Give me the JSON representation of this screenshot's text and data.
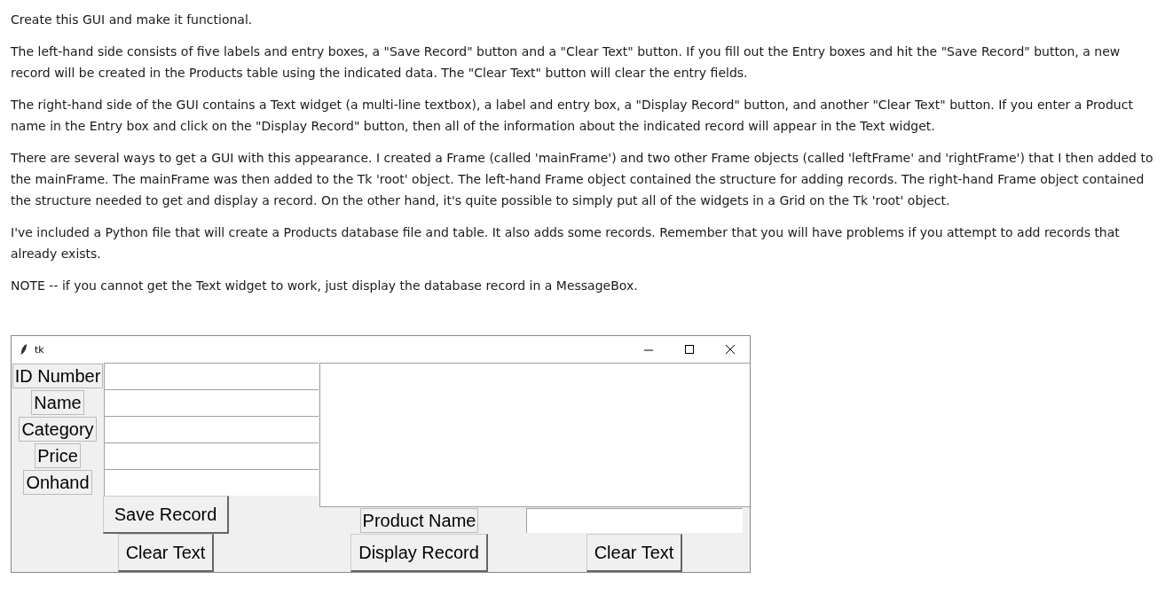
{
  "instructions": [
    "Create this GUI and make it functional.",
    "The left-hand side consists of five labels and entry boxes, a \"Save Record\" button and a \"Clear Text\" button.  If you fill out the Entry boxes and hit the \"Save Record\" button, a new record will be created in the Products table using the indicated data.  The \"Clear Text\" button will clear the entry fields.",
    "The right-hand side of the GUI contains a Text widget (a multi-line textbox), a label and entry box, a \"Display Record\" button, and another \"Clear Text\" button. If you enter a Product name in the Entry box and click on the \"Display Record\" button, then all of the information about the indicated record will appear in the Text widget.",
    "There are several ways to get a GUI with this appearance.  I created a Frame (called 'mainFrame') and two other Frame objects (called 'leftFrame' and 'rightFrame') that I then added to the mainFrame.  The mainFrame was then added to the Tk 'root' object.   The left-hand Frame object contained the structure for adding records.  The right-hand Frame object contained the structure needed to get and display a record.   On the other hand, it's quite possible to simply put all of the widgets in a Grid on the Tk 'root' object.",
    "I've included a Python file that will create a Products database file and table.  It also adds some records.  Remember that you will have problems if you attempt to add records that already exists.",
    "NOTE -- if you cannot get the Text widget to work, just display the database record in a MessageBox."
  ],
  "window": {
    "title": "tk"
  },
  "left_frame": {
    "fields": [
      {
        "label": "ID Number"
      },
      {
        "label": "Name"
      },
      {
        "label": "Category"
      },
      {
        "label": "Price"
      },
      {
        "label": "Onhand"
      }
    ],
    "buttons": [
      "Save Record",
      "Clear Text"
    ]
  },
  "right_frame": {
    "product_label": "Product Name",
    "buttons": [
      "Display Record",
      "Clear Text"
    ]
  }
}
